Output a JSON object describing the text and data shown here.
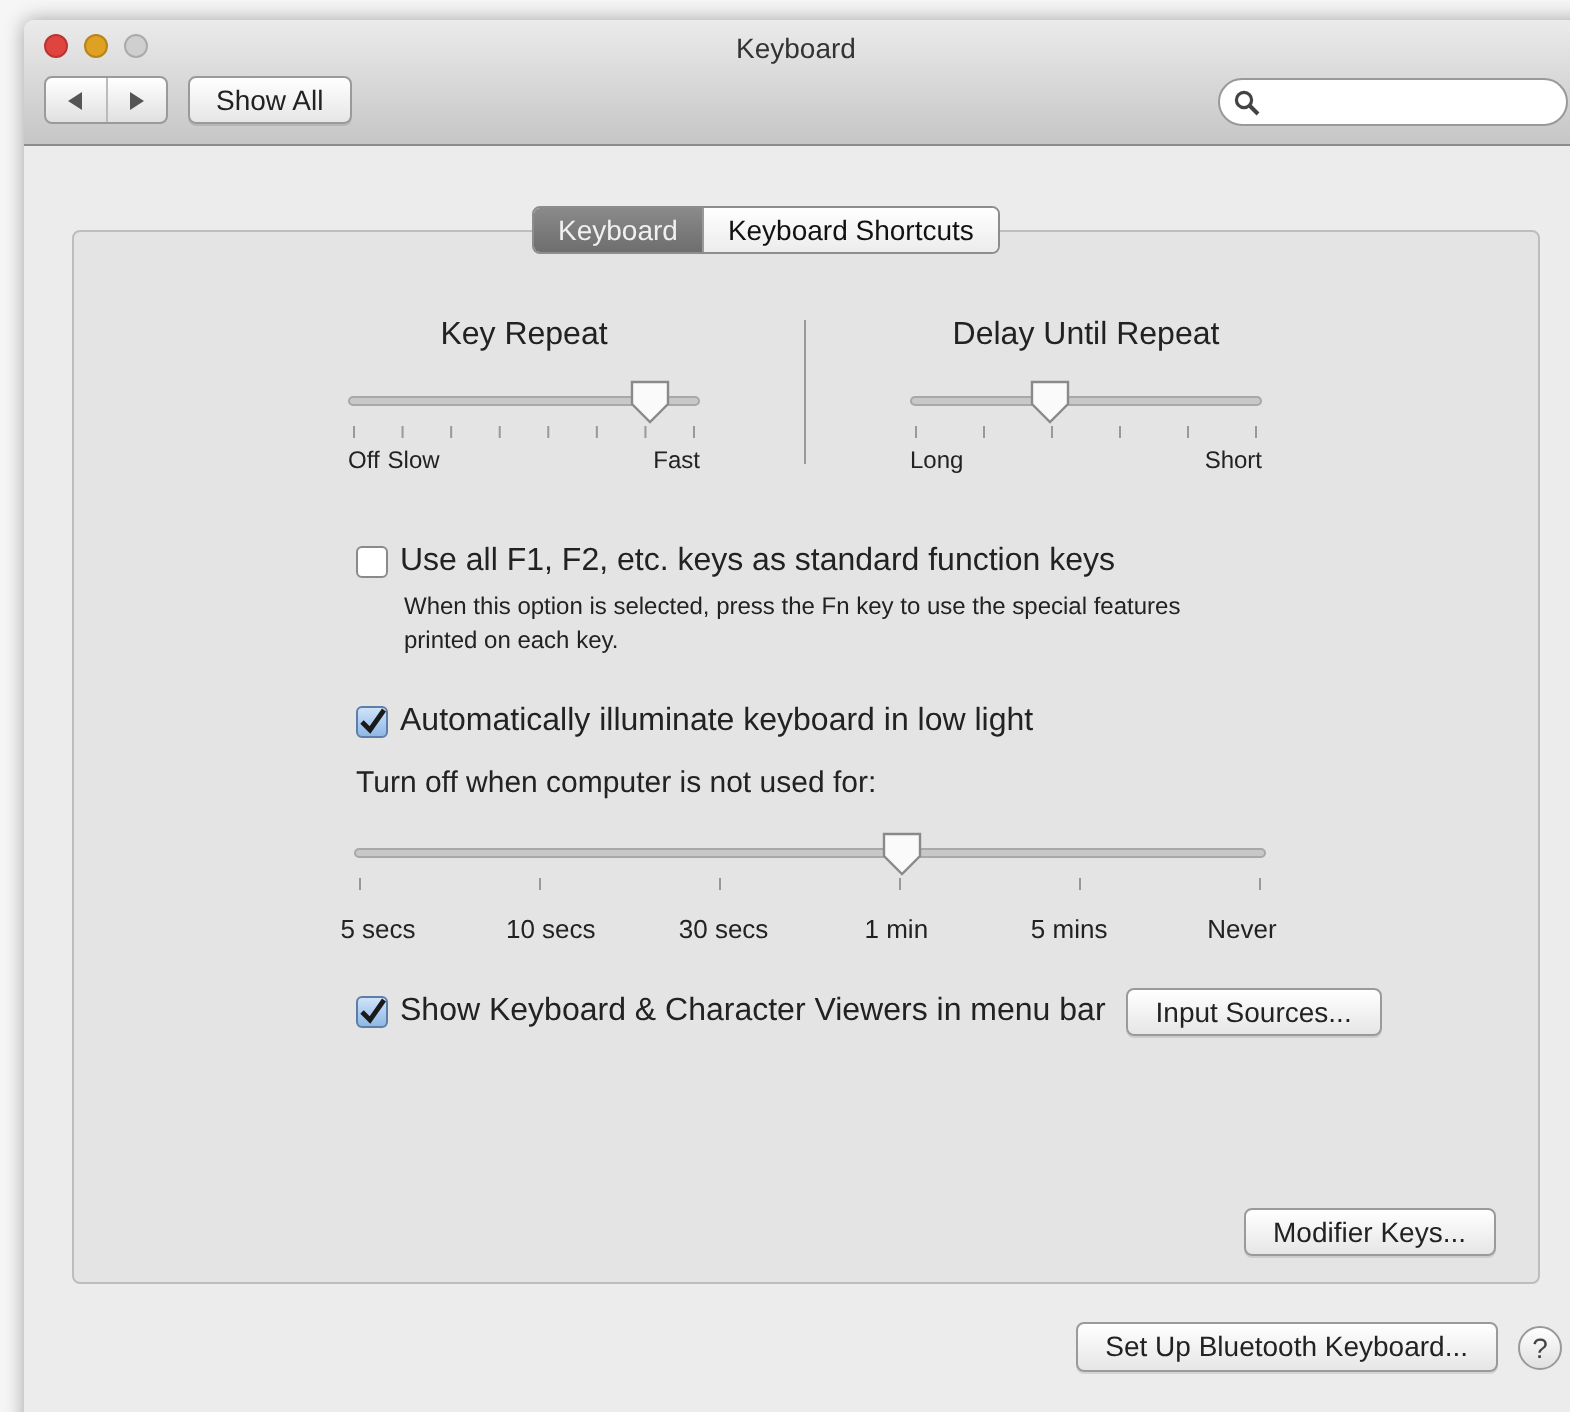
{
  "window": {
    "title": "Keyboard"
  },
  "toolbar": {
    "show_all": "Show All"
  },
  "tabs": [
    {
      "label": "Keyboard",
      "selected": true
    },
    {
      "label": "Keyboard Shortcuts",
      "selected": false
    }
  ],
  "sliders": [
    {
      "title": "Key Repeat",
      "level": 0.857,
      "labels_left": [
        "Off",
        "Slow"
      ],
      "labels_right": [
        "Fast"
      ]
    },
    {
      "title": "Delay Until Repeat",
      "level": 0.4,
      "labels_left": [
        "Long"
      ],
      "labels_right": [
        "Short"
      ]
    }
  ],
  "function_keys": {
    "label": "Use all F1, F2, etc. keys as standard function keys",
    "checked": false,
    "note": "When this option is selected, press the Fn key to use the special features printed on each key."
  },
  "illuminate": {
    "label": "Automatically illuminate keyboard in low light",
    "checked": true
  },
  "turn_off": {
    "label": "Turn off when computer is not used for:",
    "level": 0.6,
    "labels": [
      "5 secs",
      "10 secs",
      "30 secs",
      "1 min",
      "5 mins",
      "Never"
    ]
  },
  "viewers": {
    "label": "Show Keyboard & Character Viewers in menu bar",
    "checked": true,
    "button": "Input Sources..."
  },
  "modifier_button": "Modifier Keys...",
  "bluetooth_button": "Set Up Bluetooth Keyboard...",
  "help_button": "?"
}
